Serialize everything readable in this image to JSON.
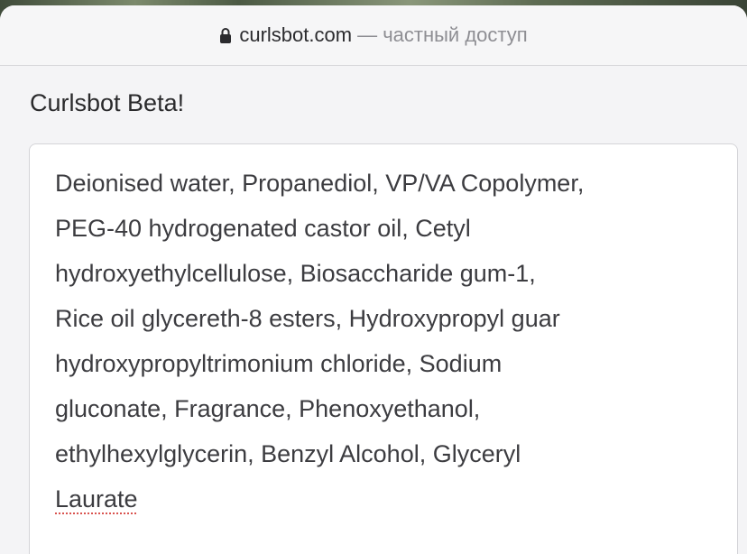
{
  "browser": {
    "domain": "curlsbot.com",
    "access_note": "— частный доступ"
  },
  "page": {
    "title": "Curlsbot Beta!"
  },
  "ingredients_input": {
    "value": "Deionised water, Propanediol, VP/VA Copolymer,\nPEG-40 hydrogenated castor oil, Cetyl\nhydroxyethylcellulose, Biosaccharide gum-1,\nRice oil glycereth-8 esters, Hydroxypropyl guar\nhydroxypropyltrimonium chloride, Sodium\ngluconate, Fragrance, Phenoxyethanol,\nethylhexylglycerin, Benzyl Alcohol, Glyceryl\n",
    "misspelled_word": "Laurate"
  },
  "icons": {
    "lock": "lock-icon"
  },
  "colors": {
    "spellcheck_underline": "#d9534f",
    "url_domain": "#2b2b2e",
    "url_suffix": "#8e8e93"
  }
}
